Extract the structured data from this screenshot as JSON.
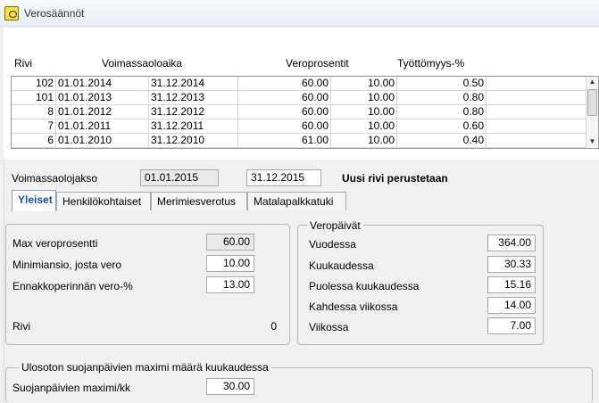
{
  "window": {
    "title": "Verosäännöt"
  },
  "table": {
    "headers": [
      "Rivi",
      "Voimassaoloaika",
      "Veroprosentit",
      "Työttömyys-%"
    ],
    "rows": [
      [
        "102",
        "01.01.2014",
        "31.12.2014",
        "60.00",
        "10.00",
        "0.50"
      ],
      [
        "101",
        "01.01.2013",
        "31.12.2013",
        "60.00",
        "10.00",
        "0.80"
      ],
      [
        "8",
        "01.01.2012",
        "31.12.2012",
        "60.00",
        "10.00",
        "0.80"
      ],
      [
        "7",
        "01.01.2011",
        "31.12.2011",
        "60.00",
        "10.00",
        "0.60"
      ],
      [
        "6",
        "01.01.2010",
        "31.12.2010",
        "61.00",
        "10.00",
        "0.40"
      ]
    ]
  },
  "period": {
    "label": "Voimassaolojakso",
    "start": "01.01.2015",
    "end": "31.12.2015",
    "status": "Uusi rivi perustetaan"
  },
  "tabs": [
    "Yleiset",
    "Henkilökohtaiset",
    "Merimiesverotus",
    "Matalapalkkatuki"
  ],
  "general": {
    "max_label": "Max veroprosentti",
    "max_value": "60.00",
    "min_label": "Minimiansio, josta vero",
    "min_value": "10.00",
    "advance_label": "Ennakkoperinnän vero-%",
    "advance_value": "13.00",
    "row_label": "Rivi",
    "row_value": "0"
  },
  "tax_days": {
    "title": "Veropäivät",
    "year_label": "Vuodessa",
    "year_value": "364.00",
    "month_label": "Kuukaudessa",
    "month_value": "30.33",
    "half_month_label": "Puolessa kuukaudessa",
    "half_month_value": "15.16",
    "two_weeks_label": "Kahdessa viikossa",
    "two_weeks_value": "14.00",
    "week_label": "Viikossa",
    "week_value": "7.00"
  },
  "protection": {
    "title": "Ulosoton suojanpäivien maximi määrä kuukaudessa",
    "label": "Suojanpäivien maximi/kk",
    "value": "30.00"
  },
  "icons": {
    "app": "tax-rules-app-icon",
    "scroll_up": "scroll-up-arrow-icon",
    "scroll_down": "scroll-down-arrow-icon"
  }
}
